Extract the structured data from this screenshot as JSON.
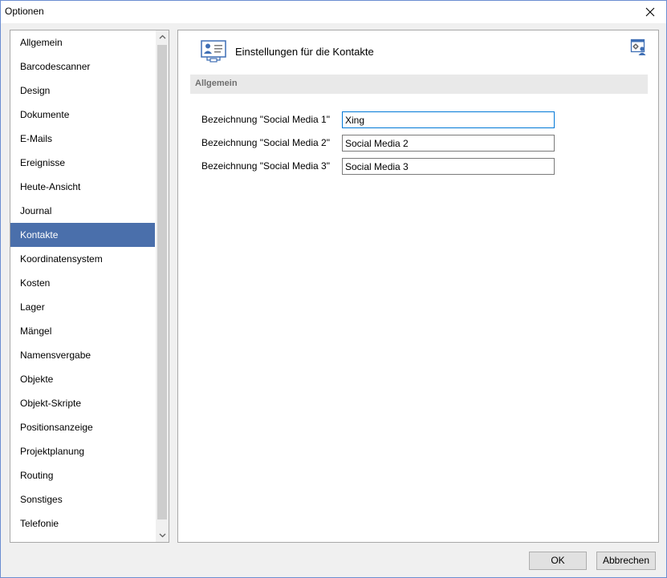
{
  "window": {
    "title": "Optionen",
    "close_icon": "close-icon"
  },
  "sidebar": {
    "items": [
      {
        "label": "Allgemein"
      },
      {
        "label": "Barcodescanner"
      },
      {
        "label": "Design"
      },
      {
        "label": "Dokumente"
      },
      {
        "label": "E-Mails"
      },
      {
        "label": "Ereignisse"
      },
      {
        "label": "Heute-Ansicht"
      },
      {
        "label": "Journal"
      },
      {
        "label": "Kontakte",
        "selected": true
      },
      {
        "label": "Koordinatensystem"
      },
      {
        "label": "Kosten"
      },
      {
        "label": "Lager"
      },
      {
        "label": "Mängel"
      },
      {
        "label": "Namensvergabe"
      },
      {
        "label": "Objekte"
      },
      {
        "label": "Objekt-Skripte"
      },
      {
        "label": "Positionsanzeige"
      },
      {
        "label": "Projektplanung"
      },
      {
        "label": "Routing"
      },
      {
        "label": "Sonstiges"
      },
      {
        "label": "Telefonie"
      }
    ]
  },
  "main": {
    "title": "Einstellungen für die Kontakte",
    "section": "Allgemein",
    "fields": [
      {
        "label": "Bezeichnung \"Social Media 1\"",
        "value": "Xing"
      },
      {
        "label": "Bezeichnung \"Social Media 2\"",
        "value": "Social Media 2"
      },
      {
        "label": "Bezeichnung \"Social Media 3\"",
        "value": "Social Media 3"
      }
    ]
  },
  "buttons": {
    "ok": "OK",
    "cancel": "Abbrechen"
  },
  "colors": {
    "selection": "#4a6fab",
    "accent": "#0078d7",
    "window_border": "#6b8ed1"
  }
}
